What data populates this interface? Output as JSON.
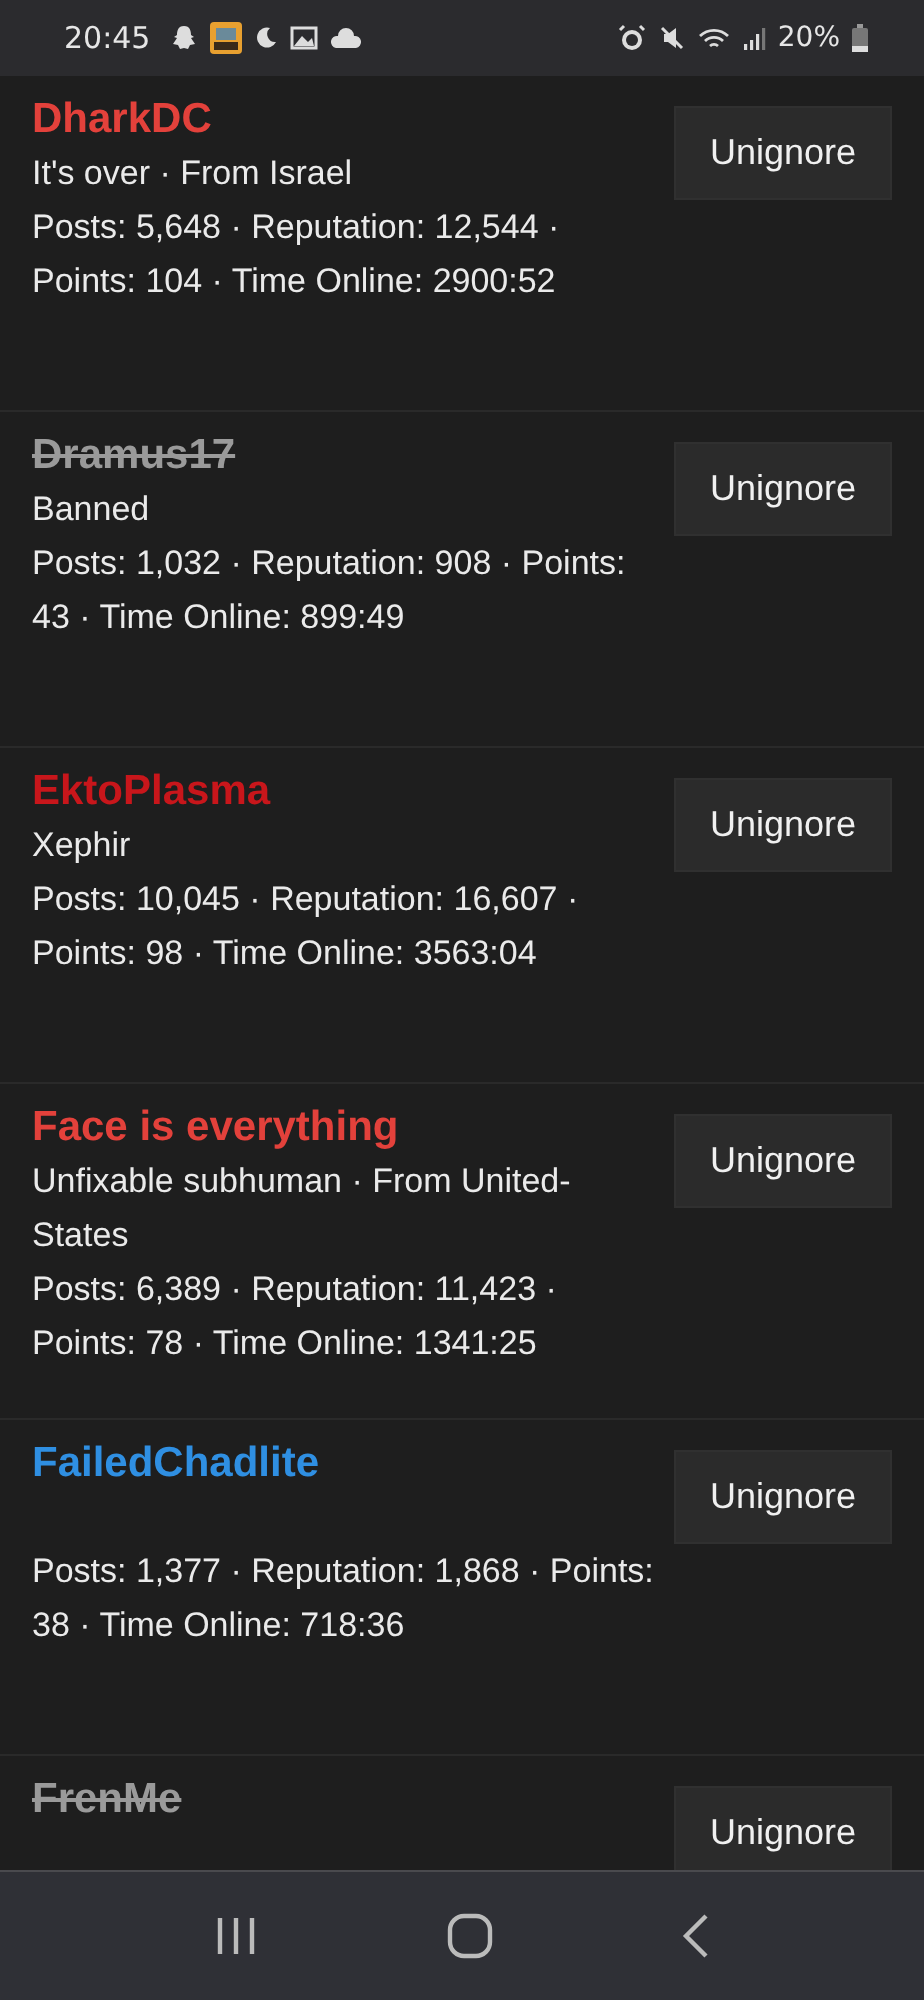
{
  "status_bar": {
    "time": "20:45",
    "battery": "20%"
  },
  "users": [
    {
      "name": "DharkDC",
      "color": "#e3413b",
      "banned": false,
      "subtitle": "It's over · From Israel",
      "stats": "Posts: 5,648 · Reputation: 12,544 · Points: 104 · Time Online: 2900:52",
      "button": "Unignore"
    },
    {
      "name": "Dramus17",
      "color": "#9a9a9a",
      "banned": true,
      "subtitle": "Banned",
      "stats": "Posts: 1,032 · Reputation: 908 · Points: 43 · Time Online: 899:49",
      "button": "Unignore"
    },
    {
      "name": "EktoPlasma",
      "color": "#c8161b",
      "banned": false,
      "subtitle": "Xephir",
      "stats": "Posts: 10,045 · Reputation: 16,607 · Points: 98 · Time Online: 3563:04",
      "button": "Unignore"
    },
    {
      "name": "Face is everything",
      "color": "#e3413b",
      "banned": false,
      "subtitle": "Unfixable subhuman · From United-States",
      "stats": "Posts: 6,389 · Reputation: 11,423 · Points: 78 · Time Online: 1341:25",
      "button": "Unignore"
    },
    {
      "name": "FailedChadlite",
      "color": "#2f8fe2",
      "banned": false,
      "stats": "Posts: 1,377 · Reputation: 1,868 · Points: 38 · Time Online: 718:36",
      "button": "Unignore"
    },
    {
      "name": "FrenMe",
      "color": "#9a9a9a",
      "banned": true,
      "button": "Unignore"
    }
  ]
}
